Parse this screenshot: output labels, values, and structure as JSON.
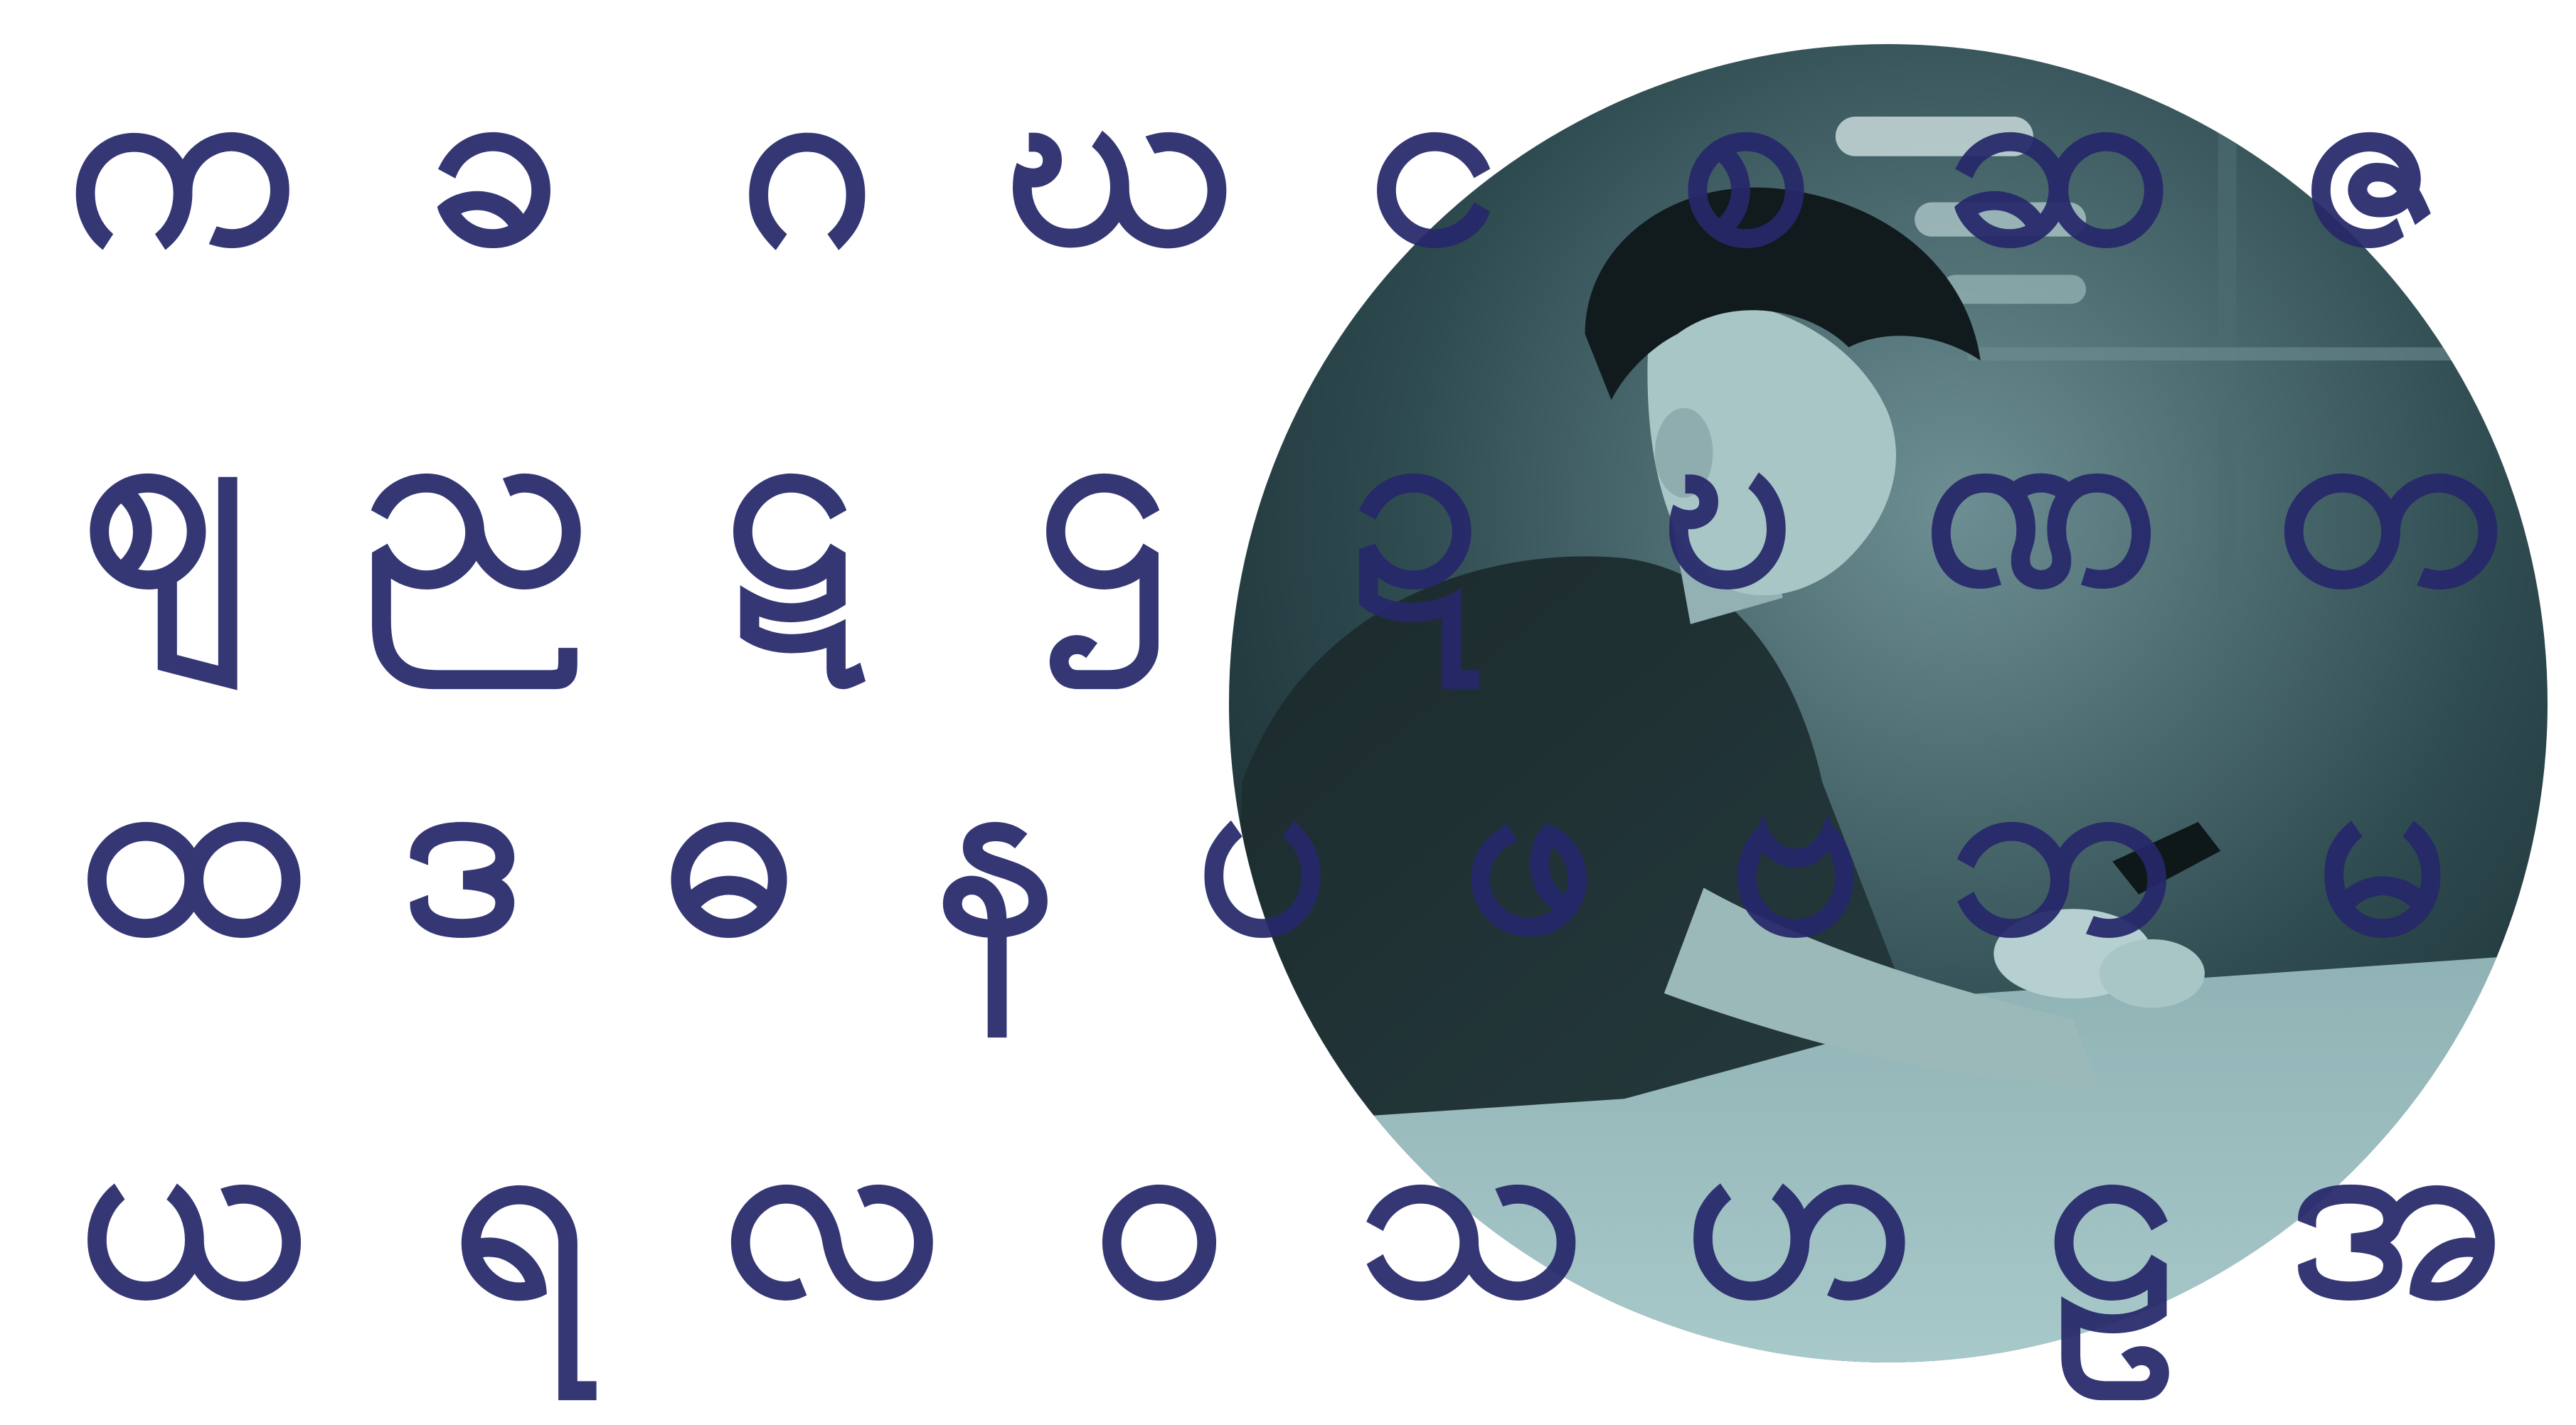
{
  "colors": {
    "letter": "#26286a",
    "background": "#ffffff",
    "photo_tint": "#2c4a4f"
  },
  "photo": {
    "subject": "person-using-phone-photo"
  },
  "alphabet_rows": [
    [
      "က",
      "ခ",
      "ဂ",
      "ဃ",
      "င",
      "စ",
      "ဆ",
      "ဇ"
    ],
    [
      "ဈ",
      "ည",
      "ဋ",
      "ဌ",
      "ဍ",
      "ဎ",
      "ဏ",
      "တ"
    ],
    [
      "ထ",
      "ဒ",
      "ဓ",
      "န",
      "ပ",
      "ဖ",
      "ဗ",
      "ဘ",
      "မ"
    ],
    [
      "ယ",
      "ရ",
      "လ",
      "ဝ",
      "သ",
      "ဟ",
      "ဠ",
      "အ"
    ]
  ]
}
